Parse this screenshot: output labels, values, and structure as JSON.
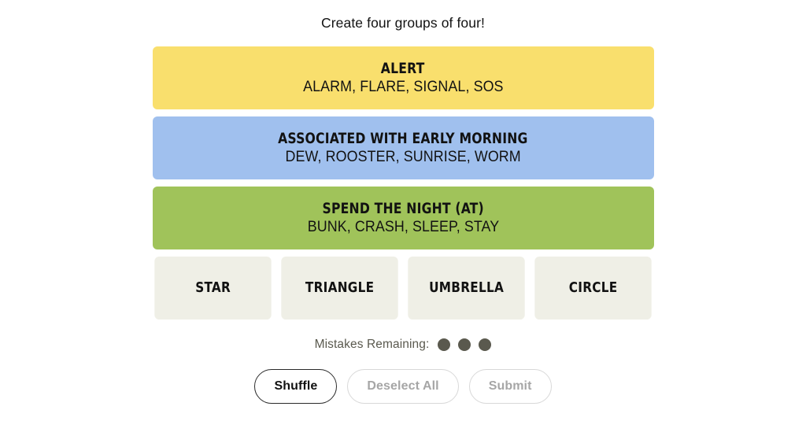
{
  "page": {
    "title": "Create four groups of four!",
    "background_color": "#ffffff"
  },
  "board": {
    "solved_groups": [
      {
        "category": "ALERT",
        "words_text": "ALARM, FLARE, SIGNAL, SOS",
        "words": [
          "ALARM",
          "FLARE",
          "SIGNAL",
          "SOS"
        ],
        "color": "#f9df6d",
        "difficulty": "yellow"
      },
      {
        "category": "ASSOCIATED WITH EARLY MORNING",
        "words_text": "DEW, ROOSTER, SUNRISE, WORM",
        "words": [
          "DEW",
          "ROOSTER",
          "SUNRISE",
          "WORM"
        ],
        "color": "#a0c0ee",
        "difficulty": "blue"
      },
      {
        "category": "SPEND THE NIGHT (AT)",
        "words_text": "BUNK, CRASH, SLEEP, STAY",
        "words": [
          "BUNK",
          "CRASH",
          "SLEEP",
          "STAY"
        ],
        "color": "#a0c35a",
        "difficulty": "green"
      }
    ],
    "remaining_tiles": [
      {
        "label": "STAR"
      },
      {
        "label": "TRIANGLE"
      },
      {
        "label": "UMBRELLA"
      },
      {
        "label": "CIRCLE"
      }
    ],
    "tile_color": "#efefe6"
  },
  "mistakes": {
    "label": "Mistakes Remaining:",
    "remaining": 3,
    "dot_color": "#5a594e",
    "dots": [
      1,
      2,
      3
    ]
  },
  "controls": {
    "shuffle": {
      "label": "Shuffle",
      "state": "enabled"
    },
    "deselect_all": {
      "label": "Deselect All",
      "state": "disabled"
    },
    "submit": {
      "label": "Submit",
      "state": "disabled"
    }
  }
}
